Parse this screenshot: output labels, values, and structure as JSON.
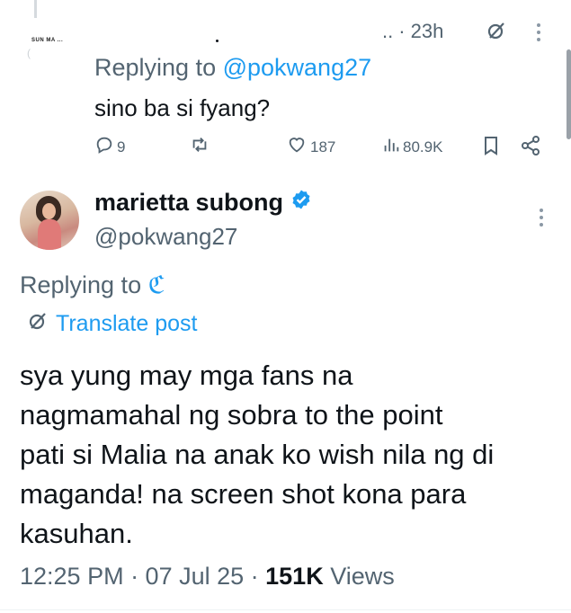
{
  "prev_post": {
    "author_name_small": "SUN MA ...",
    "time": "· 23h",
    "ellipsis": "..",
    "replying_prefix": "Replying to ",
    "replying_handle": "@pokwang27",
    "text": "sino ba si fyang?",
    "counts": {
      "replies": "9",
      "reposts": "",
      "likes": "187",
      "views": "80.9K"
    }
  },
  "main_post": {
    "name": "marietta subong",
    "handle": "@pokwang27",
    "replying_prefix": "Replying to ",
    "replying_target": "ℭ",
    "translate_label": "Translate post",
    "body_lines": [
      "sya yung may mga fans na",
      "nagmamahal ng sobra to the point",
      "pati si Malia na anak ko wish nila ng di",
      "maganda! na screen shot kona para",
      "kasuhan."
    ],
    "timestamp": "12:25 PM · 07 Jul 25 · ",
    "views_count": "151K",
    "views_label": " Views"
  },
  "colors": {
    "accent": "#1d9bf0",
    "secondary_text": "#536471",
    "primary_text": "#0f1419",
    "verified": "#1d9bf0"
  },
  "icons": {
    "reply": "reply-icon",
    "repost": "repost-icon",
    "like": "heart-icon",
    "views": "views-icon",
    "bookmark": "bookmark-icon",
    "share": "share-icon",
    "grok": "grok-icon",
    "more": "more-vertical-icon",
    "verified": "verified-badge-icon",
    "translate": "translate-icon"
  }
}
